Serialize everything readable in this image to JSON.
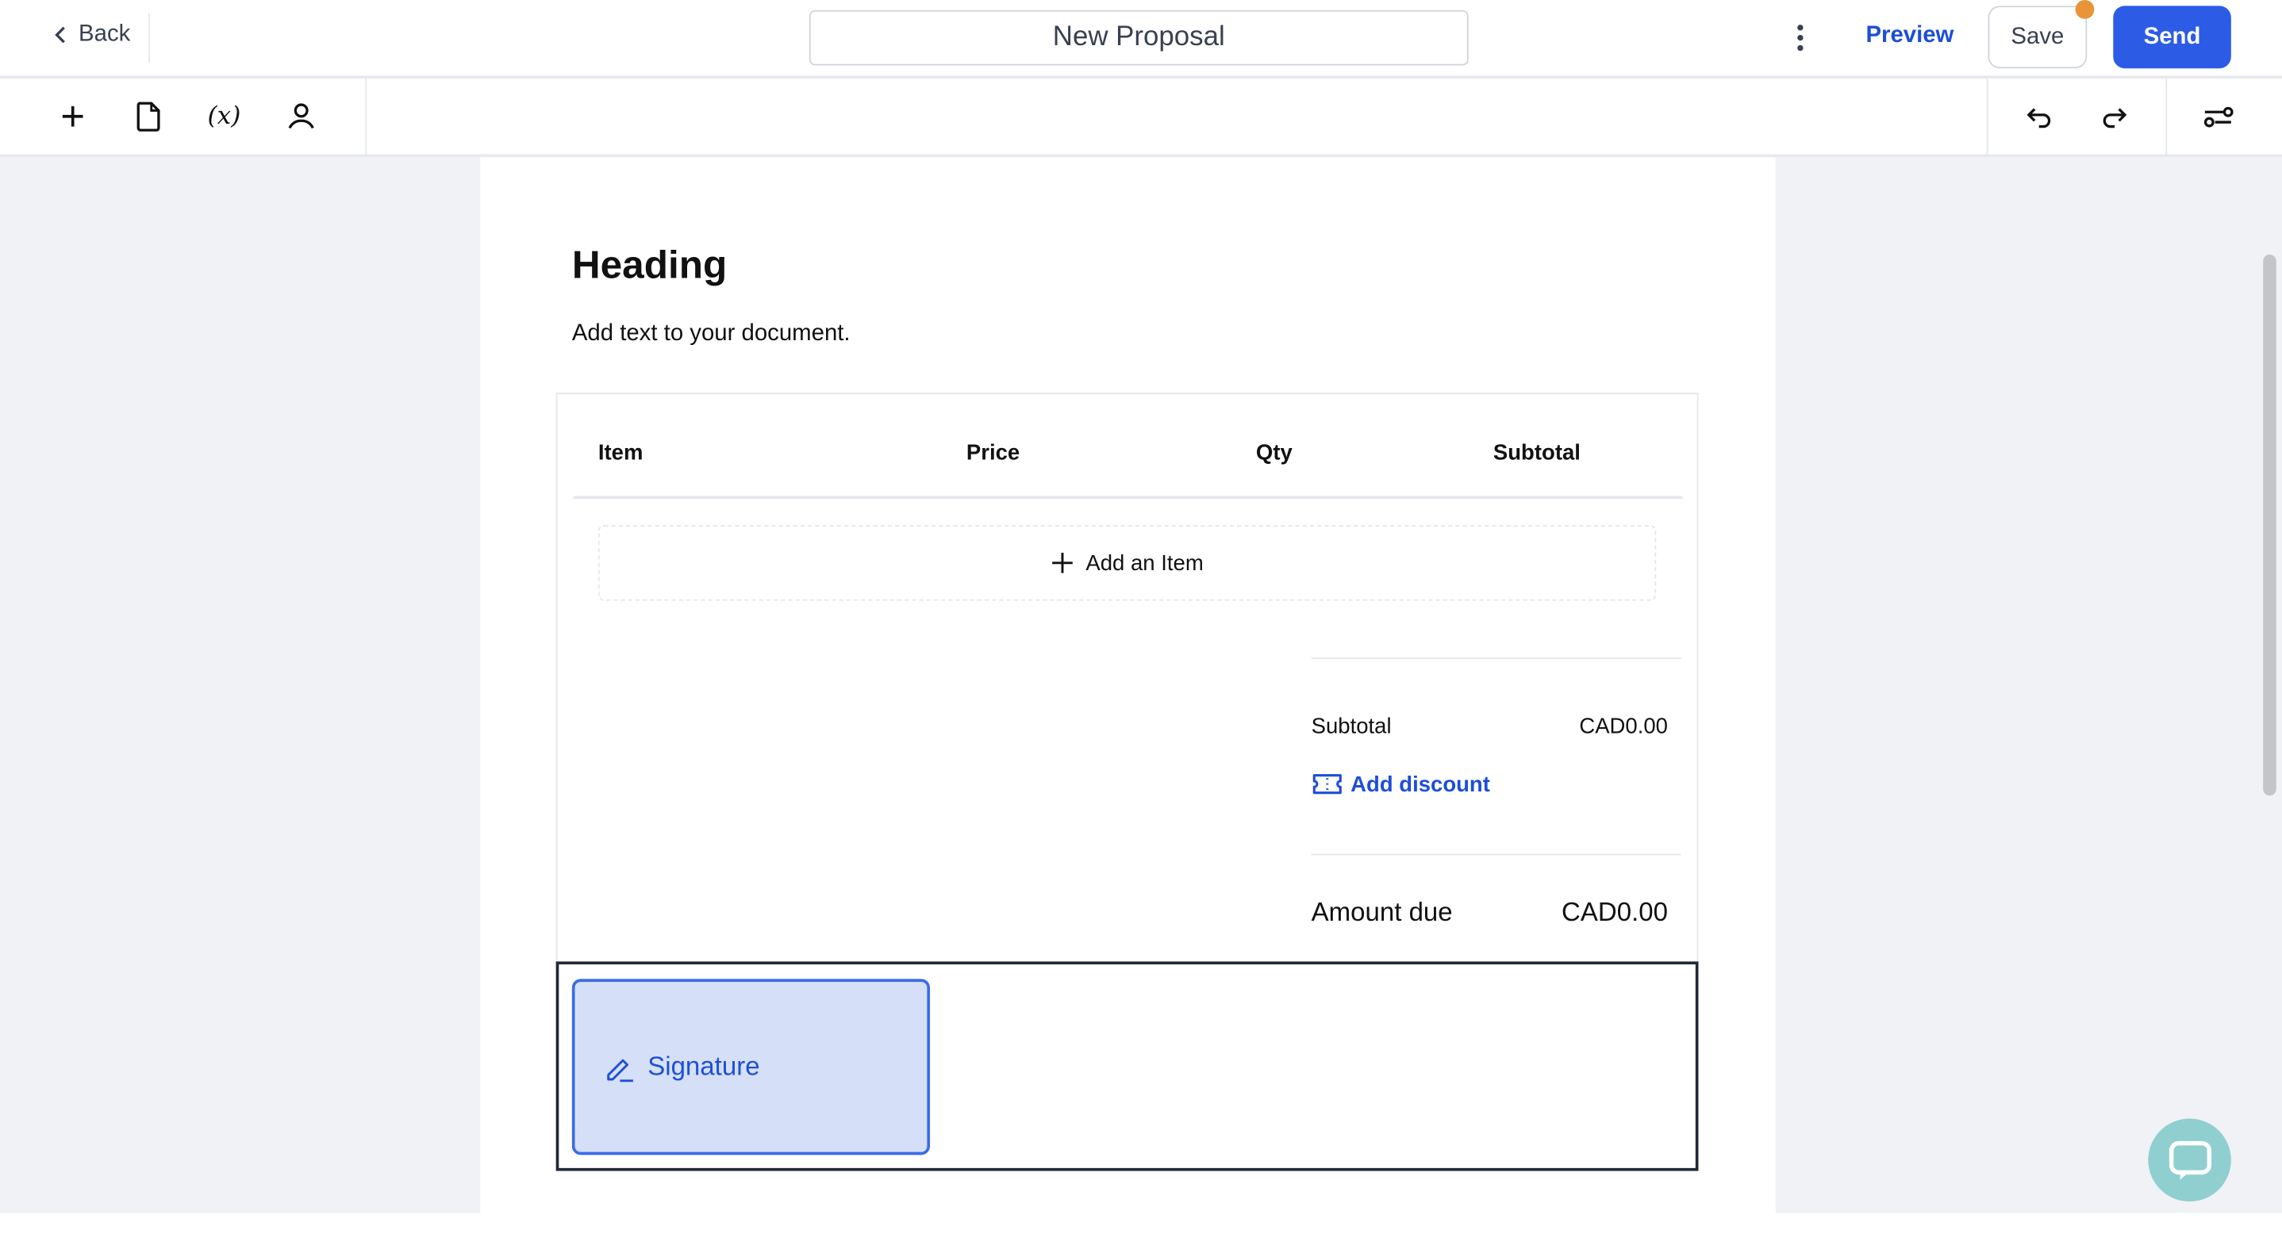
{
  "header": {
    "back_label": "Back",
    "document_title": "New Proposal",
    "preview_label": "Preview",
    "save_label": "Save",
    "send_label": "Send",
    "accent_color": "#2c5ce5",
    "unsaved_dot_color": "#e8953a"
  },
  "toolbar": {
    "left_icons": [
      "plus-icon",
      "document-icon",
      "variable-icon",
      "user-icon"
    ],
    "right_icons": [
      "undo-icon",
      "redo-icon",
      "settings-sliders-icon"
    ]
  },
  "document": {
    "heading": "Heading",
    "paragraph": "Add text to your document.",
    "table": {
      "columns": [
        "Item",
        "Price",
        "Qty",
        "Subtotal"
      ],
      "add_item_label": "Add an Item"
    },
    "summary": {
      "subtotal_label": "Subtotal",
      "subtotal_value": "CAD0.00",
      "add_discount_label": "Add discount",
      "amount_due_label": "Amount due",
      "amount_due_value": "CAD0.00"
    },
    "signature_label": "Signature"
  }
}
